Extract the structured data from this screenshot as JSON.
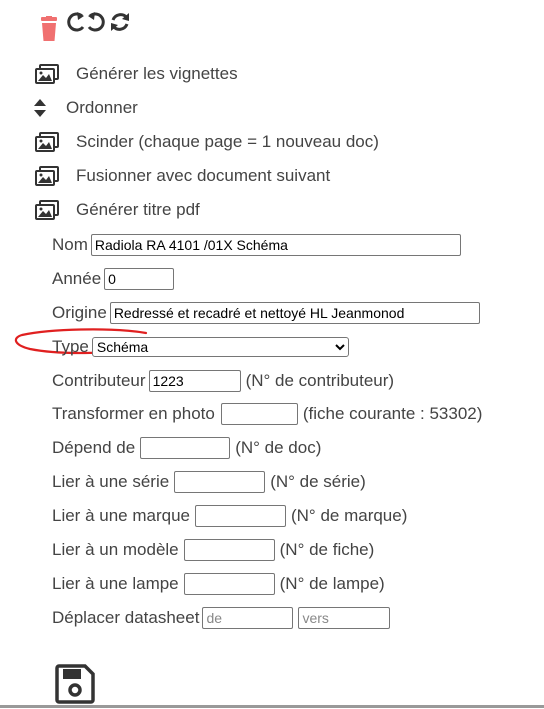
{
  "toolbar": {
    "icons": [
      "trash-icon",
      "rotate-left-icon",
      "rotate-right-icon"
    ]
  },
  "actions": {
    "generate_thumbnails": "Générer les vignettes",
    "reorder": "Ordonner",
    "split": "Scinder (chaque page = 1 nouveau doc)",
    "merge_next": "Fusionner avec document suivant",
    "generate_pdf_title": "Générer titre pdf"
  },
  "form": {
    "nom": {
      "label": "Nom",
      "value": "Radiola RA 4101 /01X Schéma"
    },
    "annee": {
      "label": "Année",
      "value": "0"
    },
    "origine": {
      "label": "Origine",
      "value": "Redressé et recadré et nettoyé HL Jeanmonod"
    },
    "type": {
      "label": "Type",
      "selected": "Schéma"
    },
    "contributeur": {
      "label": "Contributeur",
      "value": "1223",
      "hint": "(N° de contributeur)"
    },
    "transformer": {
      "label": "Transformer en photo",
      "value": "",
      "hint": "(fiche courante : 53302)"
    },
    "depend": {
      "label": "Dépend de",
      "value": "",
      "hint": "(N° de doc)"
    },
    "serie": {
      "label": "Lier à une série",
      "value": "",
      "hint": "(N° de série)"
    },
    "marque": {
      "label": "Lier à une marque",
      "value": "",
      "hint": "(N° de marque)"
    },
    "modele": {
      "label": "Lier à un modèle",
      "value": "",
      "hint": "(N° de fiche)"
    },
    "lampe": {
      "label": "Lier à une lampe",
      "value": "",
      "hint": "(N° de lampe)"
    },
    "deplacer": {
      "label": "Déplacer datasheet",
      "from_placeholder": "de",
      "to_placeholder": "vers"
    }
  },
  "colors": {
    "trash": "#f07070",
    "annotation": "#e02020",
    "icon": "#333333"
  }
}
